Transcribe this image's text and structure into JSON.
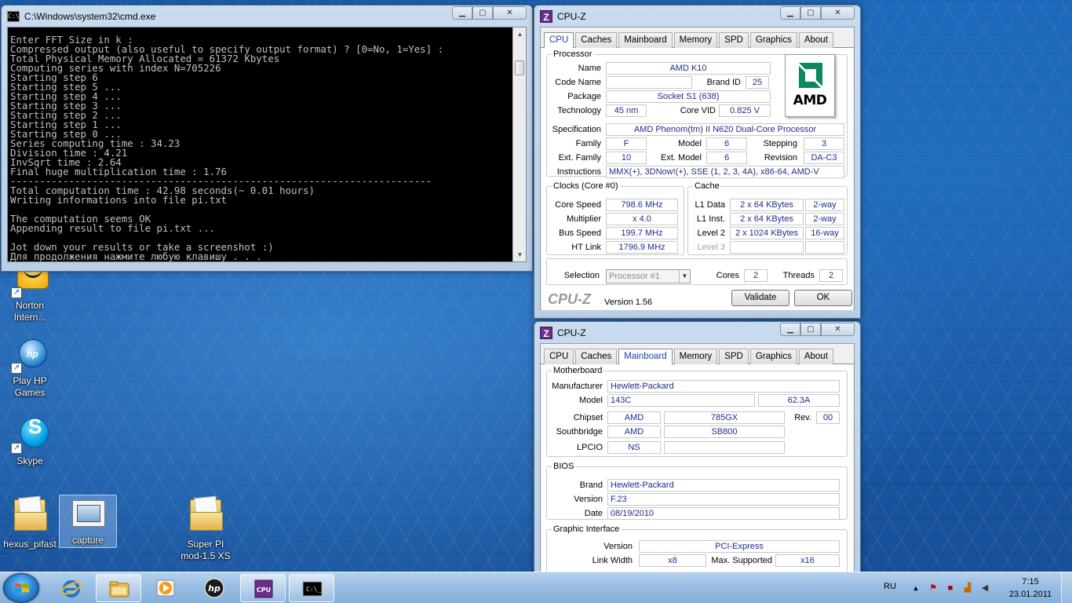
{
  "desktop": {
    "icons": [
      {
        "label": "Norton\nIntern..."
      },
      {
        "label": "Play HP\nGames"
      },
      {
        "label": "Skype"
      },
      {
        "label": "hexus_pifast"
      },
      {
        "label": "capture"
      },
      {
        "label": "Super PI\nmod-1.5 XS"
      }
    ]
  },
  "cmd": {
    "title": "C:\\Windows\\system32\\cmd.exe",
    "lines": [
      "Enter FFT Size in k :",
      "Compressed output (also useful to specify output format) ? [0=No, 1=Yes] :",
      "Total Physical Memory Allocated = 61372 Kbytes",
      "Computing series with index N=705226",
      "Starting step 6",
      "Starting step 5 ...",
      "Starting step 4 ...",
      "Starting step 3 ...",
      "Starting step 2 ...",
      "Starting step 1 ...",
      "Starting step 0 ...",
      "Series computing time : 34.23",
      "Division time : 4.21",
      "InvSqrt time : 2.64",
      "Final huge multiplication time : 1.76",
      "------------------------------------------------------------------------",
      "Total computation time : 42.98 seconds(~ 0.01 hours)",
      "Writing informations into file pi.txt",
      "",
      "The computation seems OK",
      "Appending result to file pi.txt ...",
      "",
      "Jot down your results or take a screenshot :)",
      "Для продолжения нажмите любую клавишу . . ."
    ]
  },
  "cpuz_cpu": {
    "title": "CPU-Z",
    "tabs": [
      "CPU",
      "Caches",
      "Mainboard",
      "Memory",
      "SPD",
      "Graphics",
      "About"
    ],
    "active_tab": "CPU",
    "processor": {
      "legend": "Processor",
      "name_label": "Name",
      "name": "AMD K10",
      "codename_label": "Code Name",
      "codename": "",
      "brandid_label": "Brand ID",
      "brandid": "25",
      "package_label": "Package",
      "package": "Socket S1 (638)",
      "technology_label": "Technology",
      "technology": "45 nm",
      "corevid_label": "Core VID",
      "corevid": "0.825 V",
      "spec_label": "Specification",
      "spec": "AMD Phenom(tm) II N620 Dual-Core Processor",
      "family_label": "Family",
      "family": "F",
      "model_label": "Model",
      "model": "6",
      "stepping_label": "Stepping",
      "stepping": "3",
      "extfamily_label": "Ext. Family",
      "extfamily": "10",
      "extmodel_label": "Ext. Model",
      "extmodel": "6",
      "revision_label": "Revision",
      "revision": "DA-C3",
      "instructions_label": "Instructions",
      "instructions": "MMX(+), 3DNow!(+), SSE (1, 2, 3, 4A), x86-64, AMD-V",
      "logo_text": "AMD"
    },
    "clocks": {
      "legend": "Clocks (Core #0)",
      "corespeed_label": "Core Speed",
      "corespeed": "798.6 MHz",
      "multiplier_label": "Multiplier",
      "multiplier": "x 4.0",
      "busspeed_label": "Bus Speed",
      "busspeed": "199.7 MHz",
      "htlink_label": "HT Link",
      "htlink": "1796.9 MHz"
    },
    "cache": {
      "legend": "Cache",
      "l1d_label": "L1 Data",
      "l1d": "2 x 64 KBytes",
      "l1d_way": "2-way",
      "l1i_label": "L1 Inst.",
      "l1i": "2 x 64 KBytes",
      "l1i_way": "2-way",
      "l2_label": "Level 2",
      "l2": "2 x 1024 KBytes",
      "l2_way": "16-way",
      "l3_label": "Level 3"
    },
    "selection_label": "Selection",
    "selection": "Processor #1",
    "cores_label": "Cores",
    "cores": "2",
    "threads_label": "Threads",
    "threads": "2",
    "brand": "CPU-Z",
    "version": "Version 1.56",
    "validate_label": "Validate",
    "ok_label": "OK"
  },
  "cpuz_mb": {
    "title": "CPU-Z",
    "tabs": [
      "CPU",
      "Caches",
      "Mainboard",
      "Memory",
      "SPD",
      "Graphics",
      "About"
    ],
    "active_tab": "Mainboard",
    "motherboard": {
      "legend": "Motherboard",
      "manufacturer_label": "Manufacturer",
      "manufacturer": "Hewlett-Packard",
      "model_label": "Model",
      "model": "143C",
      "model_rev": "62.3A",
      "chipset_label": "Chipset",
      "chipset_vendor": "AMD",
      "chipset": "785GX",
      "rev_label": "Rev.",
      "rev": "00",
      "southbridge_label": "Southbridge",
      "southbridge_vendor": "AMD",
      "southbridge": "SB800",
      "lpcio_label": "LPCIO",
      "lpcio": "NS"
    },
    "bios": {
      "legend": "BIOS",
      "brand_label": "Brand",
      "brand": "Hewlett-Packard",
      "version_label": "Version",
      "version": "F.23",
      "date_label": "Date",
      "date": "08/19/2010"
    },
    "graphic": {
      "legend": "Graphic Interface",
      "version_label": "Version",
      "version": "PCI-Express",
      "linkwidth_label": "Link Width",
      "linkwidth": "x8",
      "maxsupported_label": "Max. Supported",
      "maxsupported": "x16"
    }
  },
  "taskbar": {
    "items": [
      {
        "icon": "windows-start-icon"
      },
      {
        "icon": "internet-explorer-icon"
      },
      {
        "icon": "explorer-folder-icon"
      },
      {
        "icon": "media-player-icon"
      },
      {
        "icon": "hp-icon"
      },
      {
        "icon": "cpuz-icon"
      },
      {
        "icon": "cmd-icon"
      }
    ],
    "language": "RU",
    "time": "7:15",
    "date": "23.01.2011"
  },
  "colors": {
    "value_text": "#1f2e8a",
    "console_bg": "#000000",
    "console_fg": "#c0c0c0",
    "amd_green": "#0a8a5a"
  }
}
